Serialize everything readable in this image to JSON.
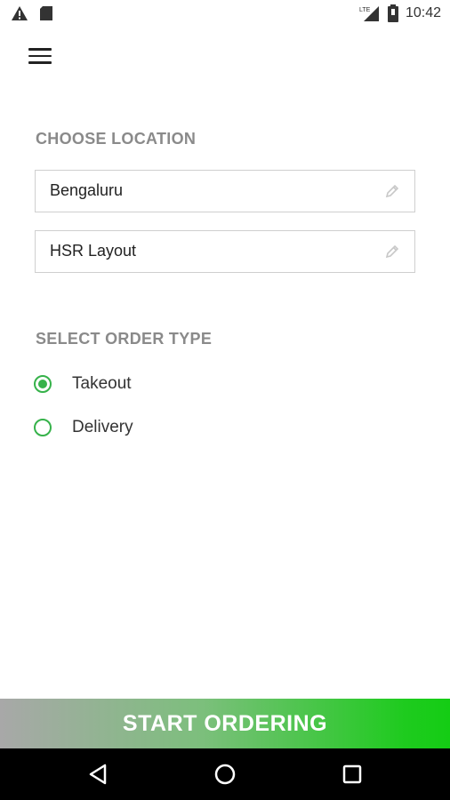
{
  "status_bar": {
    "time": "10:42",
    "network_label": "LTE",
    "left_icons": [
      "warning-icon",
      "sd-card-icon"
    ],
    "right_icons": [
      "signal-icon",
      "battery-icon"
    ]
  },
  "app_bar": {
    "menu_icon": "hamburger-menu-icon"
  },
  "location": {
    "section_title": "CHOOSE LOCATION",
    "city_value": "Bengaluru",
    "area_value": "HSR Layout",
    "edit_icon": "pencil-icon"
  },
  "order_type": {
    "section_title": "SELECT ORDER TYPE",
    "options": [
      {
        "label": "Takeout",
        "selected": true
      },
      {
        "label": "Delivery",
        "selected": false
      }
    ]
  },
  "cta": {
    "label": "START ORDERING"
  },
  "colors": {
    "accent": "#36b24a",
    "cta_end": "#14cc14",
    "section_label": "#8a8a8a"
  },
  "nav_bar": {
    "icons": [
      "back-icon",
      "home-icon",
      "recents-icon"
    ]
  }
}
